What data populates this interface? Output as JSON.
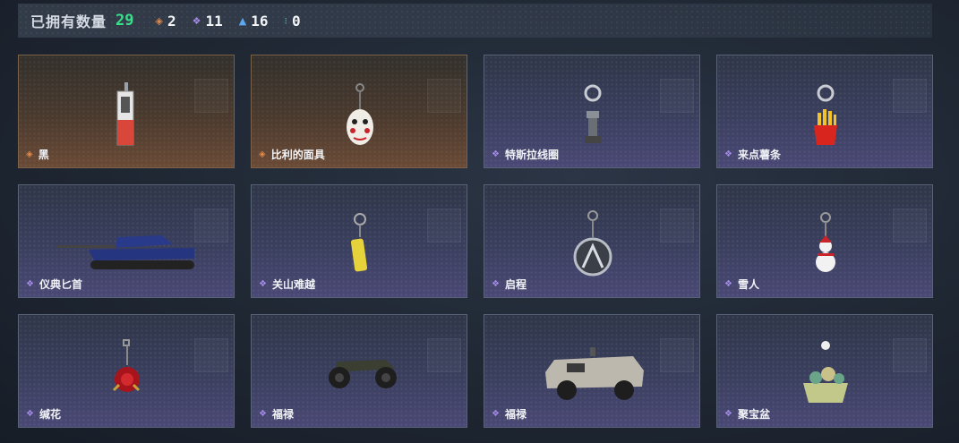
{
  "header": {
    "owned_label": "已拥有数量",
    "owned_count": "29",
    "stats": [
      {
        "glyph": "◈",
        "color": "#e08a4a",
        "value": "2",
        "icon": "orange-rarity-icon"
      },
      {
        "glyph": "❖",
        "color": "#a58be8",
        "value": "11",
        "icon": "purple-rarity-icon"
      },
      {
        "glyph": "▲",
        "color": "#5ea8f0",
        "value": "16",
        "icon": "blue-rarity-icon"
      },
      {
        "glyph": "⁝",
        "color": "#3fd2a0",
        "value": "0",
        "icon": "green-rarity-icon"
      }
    ]
  },
  "items": [
    {
      "name": "黑",
      "rarity": "orange"
    },
    {
      "name": "比利的面具",
      "rarity": "orange"
    },
    {
      "name": "特斯拉线圈",
      "rarity": "purple"
    },
    {
      "name": "来点薯条",
      "rarity": "purple"
    },
    {
      "name": "仪典匕首",
      "rarity": "purple"
    },
    {
      "name": "关山难越",
      "rarity": "purple"
    },
    {
      "name": "启程",
      "rarity": "purple"
    },
    {
      "name": "雪人",
      "rarity": "purple"
    },
    {
      "name": "缄花",
      "rarity": "purple"
    },
    {
      "name": "福禄",
      "rarity": "purple"
    },
    {
      "name": "福禄",
      "rarity": "purple"
    },
    {
      "name": "聚宝盆",
      "rarity": "purple"
    }
  ],
  "rarity_glyphs": {
    "orange": "◈",
    "purple": "❖"
  }
}
